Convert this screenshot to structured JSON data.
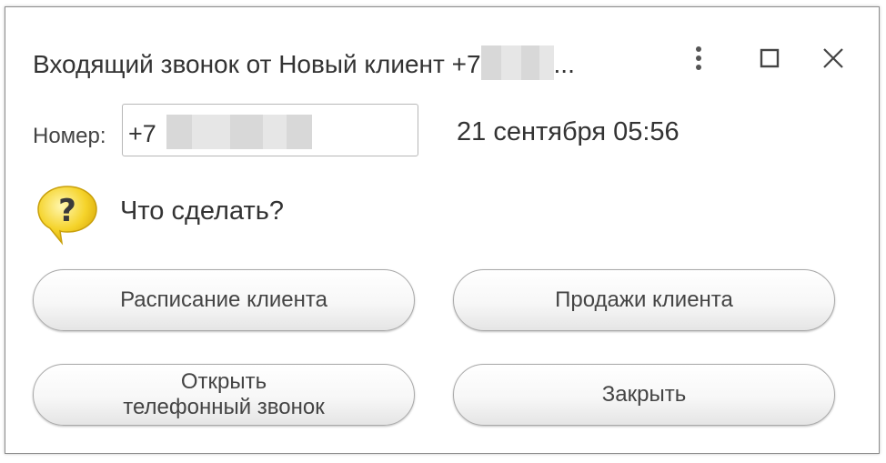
{
  "window": {
    "title": "Входящий звонок от Новый клиент +7",
    "title_suffix": "...",
    "controls": {
      "more": "more-vertical-icon",
      "maximize": "maximize-icon",
      "close": "close-icon"
    }
  },
  "call": {
    "number_label": "Номер:",
    "number_prefix": "+7",
    "datetime": "21 сентября 05:56"
  },
  "prompt": {
    "icon": "question-bubble-icon",
    "text": "Что сделать?"
  },
  "actions": {
    "schedule": "Расписание клиента",
    "sales": "Продажи клиента",
    "open_call": "Открыть\nтелефонный звонок",
    "close": "Закрыть"
  },
  "colors": {
    "border": "#8d8d8d",
    "button_border": "#a9a9a9",
    "icon_yellow": "#f5d32a",
    "text": "#333333"
  }
}
